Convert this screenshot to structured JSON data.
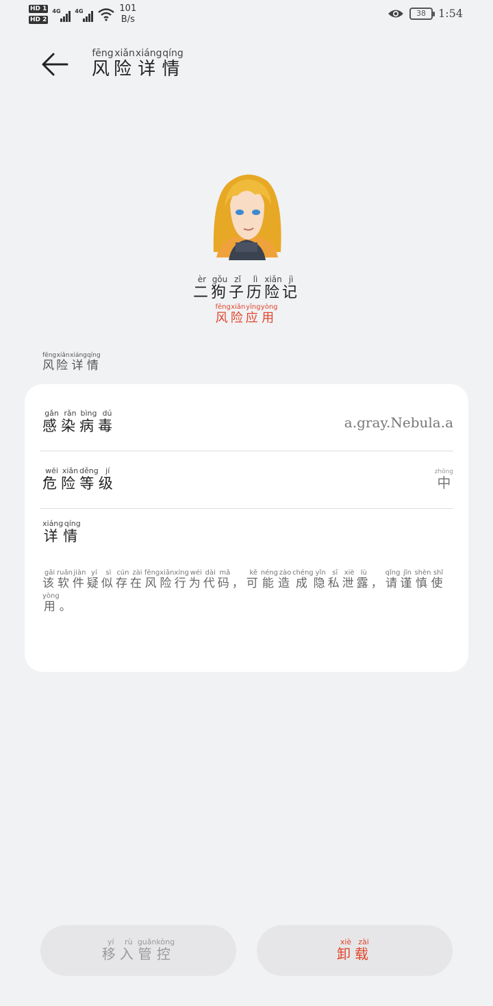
{
  "status_bar": {
    "sim1": "HD 1",
    "sim2": "HD 2",
    "net1": "4G",
    "net2": "4G",
    "speed_value": "101",
    "speed_unit": "B/s",
    "battery": "38",
    "time": "1:54",
    "icons": [
      "wifi-icon",
      "eye-icon",
      "battery-icon"
    ]
  },
  "header": {
    "title_chars": [
      "风",
      "险",
      "详",
      "情"
    ],
    "title_pinyin": [
      "fēng",
      "xiǎn",
      "xiáng",
      "qíng"
    ]
  },
  "app": {
    "name_chars": [
      "二",
      "狗",
      "子",
      "历",
      "险",
      "记"
    ],
    "name_pinyin": [
      "èr",
      "gǒu",
      "zǐ",
      "lì",
      "xiǎn",
      "jì"
    ],
    "tag_chars": [
      "风",
      "险",
      "应",
      "用"
    ],
    "tag_pinyin": [
      "fēng",
      "xiǎn",
      "yīng",
      "yòng"
    ],
    "tag_color": "#e0452b"
  },
  "section": {
    "label_chars": [
      "风",
      "险",
      "详",
      "情"
    ],
    "label_pinyin": [
      "fēng",
      "xiǎn",
      "xiáng",
      "qíng"
    ]
  },
  "details": {
    "virus_label_chars": [
      "感",
      "染",
      "病",
      "毒"
    ],
    "virus_label_pinyin": [
      "gǎn",
      "rǎn",
      "bìng",
      "dú"
    ],
    "virus_value": "a.gray.Nebula.a",
    "level_label_chars": [
      "危",
      "险",
      "等",
      "级"
    ],
    "level_label_pinyin": [
      "wēi",
      "xiǎn",
      "děng",
      "jí"
    ],
    "level_value": "中",
    "level_value_pinyin": "zhōng",
    "detail_label_chars": [
      "详",
      "情"
    ],
    "detail_label_pinyin": [
      "xiáng",
      "qíng"
    ],
    "desc_chars": [
      "该",
      "软",
      "件",
      "疑",
      "似",
      "存",
      "在",
      "风",
      "险",
      "行",
      "为",
      "代",
      "码",
      "，",
      "可",
      "能",
      "造",
      "成",
      "隐",
      "私",
      "泄",
      "露",
      "，",
      "请",
      "谨",
      "慎",
      "使",
      "用",
      "。"
    ],
    "desc_pinyin": [
      "gāi",
      "ruǎn",
      "jiàn",
      "yí",
      "sì",
      "cún",
      "zài",
      "fēng",
      "xiǎn",
      "xíng",
      "wéi",
      "dài",
      "mǎ",
      "",
      "kě",
      "néng",
      "zào",
      "chéng",
      "yǐn",
      "sī",
      "xiè",
      "lù",
      "",
      "qǐng",
      "jǐn",
      "shèn",
      "shǐ",
      "yòng",
      ""
    ]
  },
  "actions": {
    "manage_chars": [
      "移",
      "入",
      "管",
      "控"
    ],
    "manage_pinyin": [
      "yí",
      "rù",
      "guǎn",
      "kòng"
    ],
    "uninstall_chars": [
      "卸",
      "载"
    ],
    "uninstall_pinyin": [
      "xiè",
      "zài"
    ]
  }
}
